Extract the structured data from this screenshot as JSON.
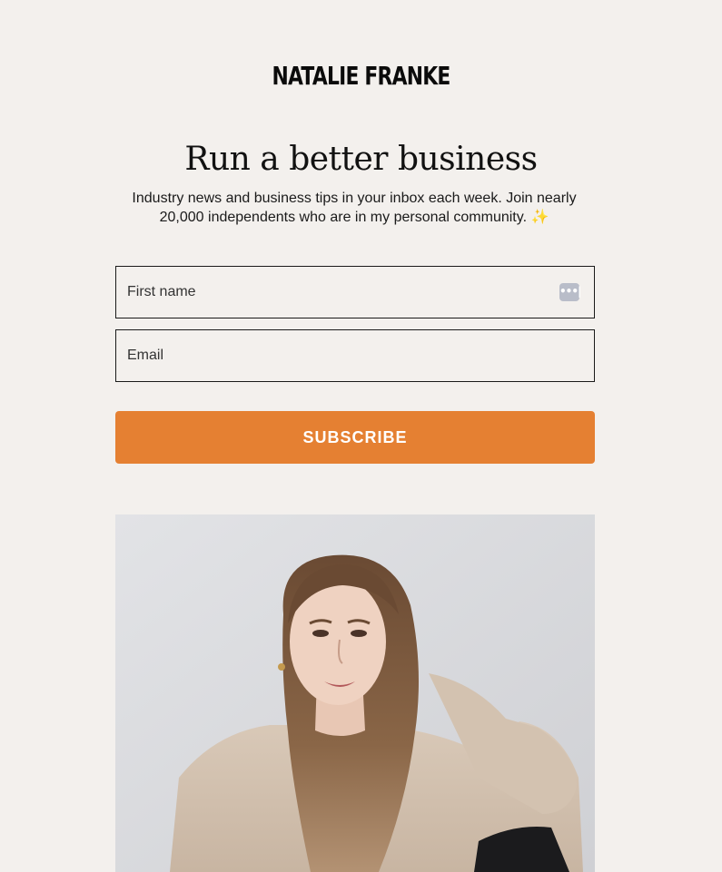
{
  "brand": {
    "logo_text": "NATALIE FRANKE"
  },
  "hero": {
    "headline": "Run a better business",
    "subtext": "Industry news and business tips in your inbox each week. Join nearly 20,000 independents who are in my personal community. ✨"
  },
  "form": {
    "first_name_placeholder": "First name",
    "email_placeholder": "Email",
    "autofill_icon_glyph": "•••|",
    "subscribe_label": "SUBSCRIBE"
  },
  "colors": {
    "background": "#f3f0ed",
    "accent": "#e58032",
    "text": "#111111"
  },
  "icons": {
    "autofill": "password-manager-icon",
    "sparkle": "sparkles-emoji"
  }
}
